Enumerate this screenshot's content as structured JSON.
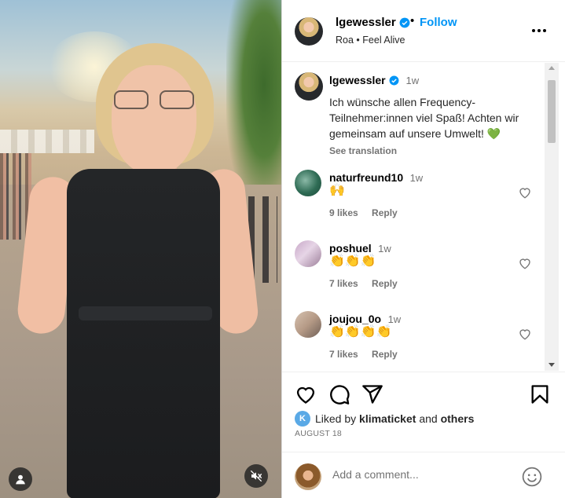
{
  "post": {
    "username": "lgewessler",
    "follow_label": "Follow",
    "subtitle_parts": [
      "Roa",
      "•",
      "Feel Alive"
    ],
    "separator": "•"
  },
  "caption": {
    "username": "lgewessler",
    "time": "1w",
    "text": "Ich wünsche allen Frequency-Teilnehmer:innen viel Spaß! Achten wir gemeinsam auf unsere Umwelt! 💚",
    "see_translation": "See translation"
  },
  "comments": [
    {
      "username": "naturfreund10",
      "time": "1w",
      "text": "🙌",
      "likes": "9 likes",
      "reply": "Reply"
    },
    {
      "username": "poshuel",
      "time": "1w",
      "text": "👏👏👏",
      "likes": "7 likes",
      "reply": "Reply"
    },
    {
      "username": "joujou_0o",
      "time": "1w",
      "text": "👏👏👏👏",
      "likes": "7 likes",
      "reply": "Reply"
    }
  ],
  "likes": {
    "prefix": "Liked by",
    "user": "klimaticket",
    "joiner": "and",
    "others": "others",
    "avatar_letter": "K"
  },
  "date": "AUGUST 18",
  "add_comment": {
    "placeholder": "Add a comment..."
  },
  "icons": {
    "verified": "verified-badge-icon",
    "more": "more-horizontal-icon",
    "heart": "heart-icon",
    "comment": "comment-icon",
    "share": "share-icon",
    "save": "bookmark-icon",
    "emoji": "smiley-icon",
    "user_tag": "user-tag-icon",
    "mute": "muted-speaker-icon"
  },
  "colors": {
    "accent": "#0095f6",
    "verified": "#0095f6",
    "muted_text": "#737373"
  }
}
